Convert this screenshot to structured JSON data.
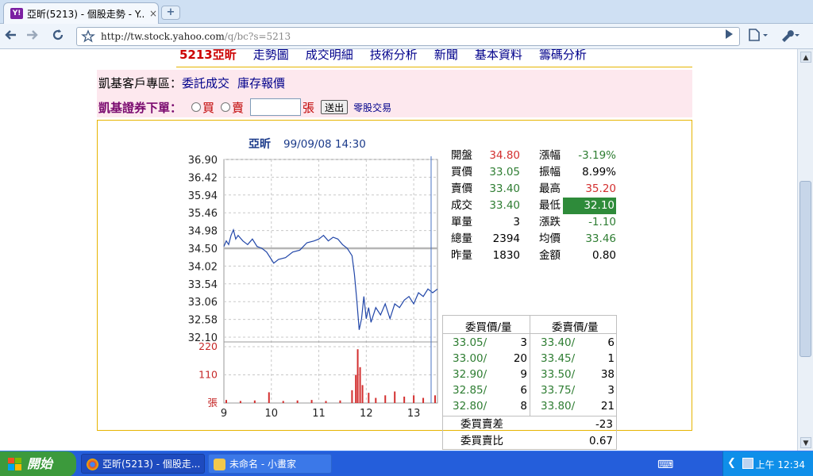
{
  "browser": {
    "tab_title": "亞昕(5213) - 個股走勢 - Y...",
    "tab_icon_text": "Y!",
    "close_glyph": "×",
    "newtab_glyph": "+",
    "url_host": "http://tw.stock.yahoo.com",
    "url_path": "/q/bc?s=5213",
    "icons": [
      "back-icon",
      "forward-icon",
      "reload-icon",
      "star-icon",
      "play-icon",
      "page-menu-icon",
      "wrench-icon"
    ]
  },
  "nav": {
    "stock_code": "5213",
    "stock_name": "亞昕",
    "links": [
      "走勢圖",
      "成交明細",
      "技術分析",
      "新聞",
      "基本資料",
      "籌碼分析"
    ]
  },
  "kgi": {
    "zone_label": "凱基客戶專區：",
    "link1": "委託成交",
    "link2": "庫存報價",
    "order_title": "凱基證券下單：",
    "buy": "買",
    "sell": "賣",
    "unit": "張",
    "submit": "送出",
    "odd_lot": "零股交易"
  },
  "chart_data": {
    "type": "line",
    "title_name": "亞昕",
    "title_time": "99/09/08 14:30",
    "y_ticks": [
      "36.90",
      "36.42",
      "35.94",
      "35.46",
      "34.98",
      "34.50",
      "34.02",
      "33.54",
      "33.06",
      "32.58",
      "32.10"
    ],
    "ylim": [
      32.1,
      36.9
    ],
    "reference_price": 34.5,
    "volume_ticks": [
      "220",
      "110",
      "張"
    ],
    "volume_max": 220,
    "x_ticks": [
      "9",
      "10",
      "11",
      "12",
      "13"
    ],
    "x_hours": [
      9,
      10,
      11,
      12,
      13
    ],
    "xlim": [
      9,
      13.5
    ],
    "price": [
      [
        9.0,
        34.55
      ],
      [
        9.05,
        34.7
      ],
      [
        9.1,
        34.6
      ],
      [
        9.15,
        34.85
      ],
      [
        9.2,
        35.0
      ],
      [
        9.25,
        34.75
      ],
      [
        9.3,
        34.85
      ],
      [
        9.4,
        34.7
      ],
      [
        9.5,
        34.6
      ],
      [
        9.6,
        34.75
      ],
      [
        9.7,
        34.55
      ],
      [
        9.8,
        34.5
      ],
      [
        9.9,
        34.4
      ],
      [
        10.0,
        34.2
      ],
      [
        10.05,
        34.1
      ],
      [
        10.15,
        34.2
      ],
      [
        10.3,
        34.25
      ],
      [
        10.45,
        34.4
      ],
      [
        10.6,
        34.45
      ],
      [
        10.75,
        34.65
      ],
      [
        10.9,
        34.7
      ],
      [
        11.0,
        34.75
      ],
      [
        11.1,
        34.85
      ],
      [
        11.2,
        34.7
      ],
      [
        11.3,
        34.8
      ],
      [
        11.4,
        34.75
      ],
      [
        11.5,
        34.6
      ],
      [
        11.6,
        34.5
      ],
      [
        11.7,
        34.3
      ],
      [
        11.75,
        33.8
      ],
      [
        11.8,
        33.1
      ],
      [
        11.85,
        32.3
      ],
      [
        11.9,
        32.6
      ],
      [
        11.95,
        33.2
      ],
      [
        12.0,
        32.6
      ],
      [
        12.05,
        32.9
      ],
      [
        12.1,
        32.5
      ],
      [
        12.2,
        32.9
      ],
      [
        12.3,
        32.7
      ],
      [
        12.4,
        33.0
      ],
      [
        12.5,
        32.6
      ],
      [
        12.6,
        33.0
      ],
      [
        12.7,
        32.9
      ],
      [
        12.8,
        33.1
      ],
      [
        12.9,
        33.2
      ],
      [
        13.0,
        33.0
      ],
      [
        13.1,
        33.3
      ],
      [
        13.2,
        33.2
      ],
      [
        13.3,
        33.4
      ],
      [
        13.4,
        33.3
      ],
      [
        13.5,
        33.4
      ]
    ],
    "volume": [
      [
        9.05,
        12
      ],
      [
        9.35,
        8
      ],
      [
        9.65,
        10
      ],
      [
        9.95,
        42
      ],
      [
        10.25,
        8
      ],
      [
        10.55,
        10
      ],
      [
        10.85,
        12
      ],
      [
        11.15,
        8
      ],
      [
        11.45,
        10
      ],
      [
        11.7,
        50
      ],
      [
        11.78,
        110
      ],
      [
        11.82,
        210
      ],
      [
        11.87,
        140
      ],
      [
        11.92,
        70
      ],
      [
        12.05,
        40
      ],
      [
        12.2,
        20
      ],
      [
        12.4,
        30
      ],
      [
        12.6,
        45
      ],
      [
        12.8,
        25
      ],
      [
        13.0,
        30
      ],
      [
        13.2,
        20
      ],
      [
        13.45,
        30
      ]
    ]
  },
  "quote": {
    "left": [
      {
        "label": "開盤",
        "value": "34.80",
        "color": "#d32f2f"
      },
      {
        "label": "買價",
        "value": "33.05",
        "color": "#2e7d32"
      },
      {
        "label": "賣價",
        "value": "33.40",
        "color": "#2e7d32"
      },
      {
        "label": "成交",
        "value": "33.40",
        "color": "#2e7d32"
      },
      {
        "label": "單量",
        "value": "3",
        "color": "#000000"
      },
      {
        "label": "總量",
        "value": "2394",
        "color": "#000000"
      },
      {
        "label": "昨量",
        "value": "1830",
        "color": "#000000"
      }
    ],
    "right": [
      {
        "label": "漲幅",
        "value": "-3.19%",
        "color": "#2e7d32"
      },
      {
        "label": "振幅",
        "value": "8.99%",
        "color": "#000000"
      },
      {
        "label": "最高",
        "value": "35.20",
        "color": "#d32f2f"
      },
      {
        "label": "最低",
        "value": "32.10",
        "color": "#ffffff"
      },
      {
        "label": "漲跌",
        "value": "-1.10",
        "color": "#2e7d32"
      },
      {
        "label": "均價",
        "value": "33.46",
        "color": "#2e7d32"
      },
      {
        "label": "金額",
        "value": "0.80",
        "color": "#000000"
      }
    ],
    "low_highlight": "#2e8b3a"
  },
  "depth": {
    "bid_header": "委買價/量",
    "ask_header": "委賣價/量",
    "bids": [
      [
        "33.05",
        "3"
      ],
      [
        "33.00",
        "20"
      ],
      [
        "32.90",
        "9"
      ],
      [
        "32.85",
        "6"
      ],
      [
        "32.80",
        "8"
      ]
    ],
    "asks": [
      [
        "33.40",
        "6"
      ],
      [
        "33.45",
        "1"
      ],
      [
        "33.50",
        "38"
      ],
      [
        "33.75",
        "3"
      ],
      [
        "33.80",
        "21"
      ]
    ],
    "diff_label": "委買賣差",
    "diff_value": "-23",
    "ratio_label": "委買賣比",
    "ratio_value": "0.67"
  },
  "taskbar": {
    "start": "開始",
    "task1": "亞昕(5213) - 個股走...",
    "task2": "未命名 - 小畫家",
    "clock": "上午 12:34"
  }
}
